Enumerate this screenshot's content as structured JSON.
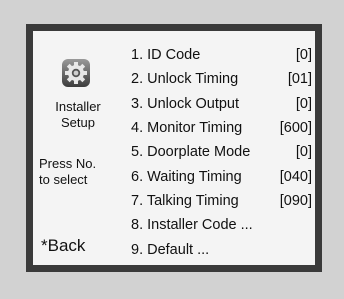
{
  "left": {
    "icon": "gear-icon",
    "installer_label": "Installer\nSetup",
    "press_label": "Press No.\nto select",
    "back_label": "*Back"
  },
  "menu": [
    {
      "label": "1. ID Code",
      "value": "[0]"
    },
    {
      "label": "2. Unlock Timing",
      "value": "[01]"
    },
    {
      "label": "3. Unlock Output",
      "value": "[0]"
    },
    {
      "label": "4. Monitor Timing",
      "value": "[600]"
    },
    {
      "label": "5. Doorplate Mode",
      "value": "[0]"
    },
    {
      "label": "6. Waiting Timing",
      "value": "[040]"
    },
    {
      "label": "7. Talking Timing",
      "value": "[090]"
    },
    {
      "label": "8. Installer Code ...",
      "value": ""
    },
    {
      "label": "9. Default ...",
      "value": ""
    }
  ]
}
